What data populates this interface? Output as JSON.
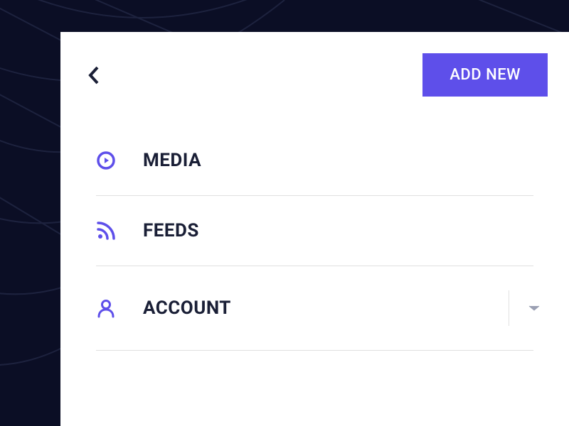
{
  "colors": {
    "accent": "#5e4fea",
    "text": "#1a1f36",
    "background_dark": "#0b0e25",
    "background_light": "#ffffff",
    "divider": "#e0e0e0",
    "dropdown_icon": "#8b8fa3"
  },
  "header": {
    "add_new_label": "ADD NEW"
  },
  "menu": {
    "items": [
      {
        "label": "MEDIA",
        "icon": "play-circle-icon",
        "has_dropdown": false
      },
      {
        "label": "FEEDS",
        "icon": "rss-icon",
        "has_dropdown": false
      },
      {
        "label": "ACCOUNT",
        "icon": "person-icon",
        "has_dropdown": true
      }
    ]
  }
}
